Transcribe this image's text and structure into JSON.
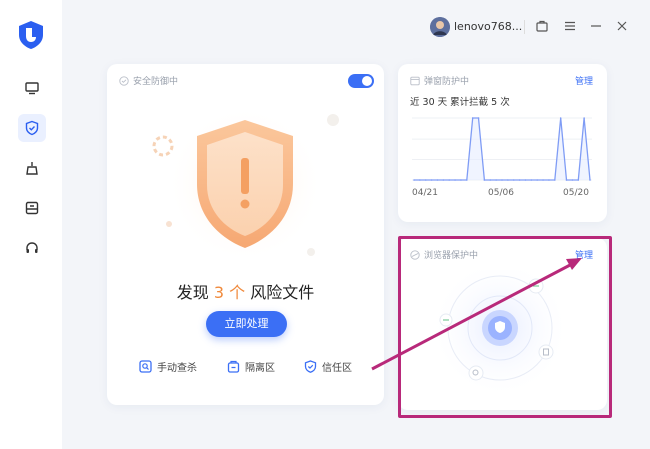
{
  "topbar": {
    "username": "lenovo768..."
  },
  "protection_card": {
    "title": "安全防御中",
    "risk_prefix": "发现",
    "risk_count": "3 个",
    "risk_suffix": "风险文件",
    "action_button": "立即处理",
    "tools": [
      {
        "label": "手动查杀",
        "icon": "scan-icon"
      },
      {
        "label": "隔离区",
        "icon": "quarantine-icon"
      },
      {
        "label": "信任区",
        "icon": "trust-shield-icon"
      }
    ],
    "toggle_on": true
  },
  "popup_card": {
    "title": "弹窗防护中",
    "manage_label": "管理",
    "caption": "近 30 天 累计拦截 5 次"
  },
  "browser_card": {
    "title": "浏览器保护中",
    "manage_label": "管理"
  },
  "sidebar": {
    "items": [
      {
        "icon": "monitor-icon"
      },
      {
        "icon": "shield-icon",
        "active": true
      },
      {
        "icon": "broom-icon"
      },
      {
        "icon": "toolbox-icon"
      },
      {
        "icon": "headset-icon"
      }
    ]
  },
  "chart_data": {
    "type": "line",
    "title": "近 30 天 累计拦截 5 次",
    "x_tick_labels": [
      "04/21",
      "05/06",
      "05/20"
    ],
    "series": [
      {
        "values": [
          0,
          0,
          0,
          0,
          0,
          0,
          0,
          0,
          0,
          0,
          1,
          1,
          0,
          0,
          0,
          0,
          0,
          0,
          0,
          0,
          0,
          0,
          0,
          0,
          0,
          1,
          0,
          0,
          0,
          1,
          0
        ]
      }
    ],
    "ylim": [
      0,
      1
    ],
    "grid": true
  },
  "colors": {
    "accent": "#3b6ff5",
    "warning": "#f08a3c",
    "annotation": "#b8297a"
  }
}
